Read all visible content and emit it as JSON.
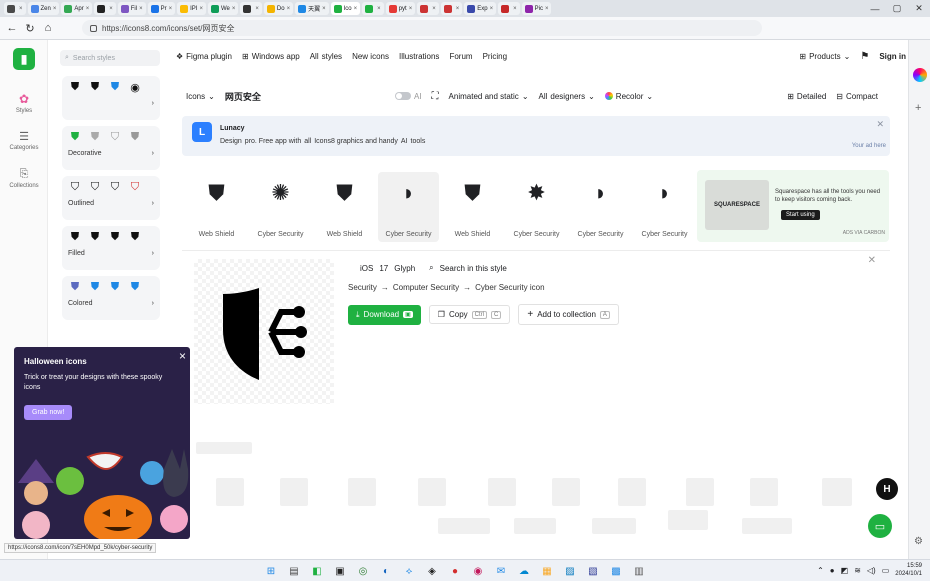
{
  "browser": {
    "tabs": [
      {
        "label": "",
        "color": "#4a4a4a"
      },
      {
        "label": "Zen",
        "color": "#4a86e8"
      },
      {
        "label": "Apr",
        "color": "#34a853"
      },
      {
        "label": "",
        "color": "#222222"
      },
      {
        "label": "Fil",
        "color": "#7e57c2"
      },
      {
        "label": "Pr",
        "color": "#1a73e8"
      },
      {
        "label": "IPI",
        "color": "#fbbc04"
      },
      {
        "label": "We",
        "color": "#0f9d58"
      },
      {
        "label": "",
        "color": "#333333"
      },
      {
        "label": "Do",
        "color": "#f4b400"
      },
      {
        "label": "天翼",
        "color": "#1e88e5"
      },
      {
        "label": "Ico",
        "color": "#1fb141"
      },
      {
        "label": "",
        "color": "#1fb141"
      },
      {
        "label": "pyt",
        "color": "#e53935"
      },
      {
        "label": "",
        "color": "#cc3333"
      },
      {
        "label": "",
        "color": "#cc3333"
      },
      {
        "label": "Exp",
        "color": "#3949ab"
      },
      {
        "label": "",
        "color": "#c62828"
      },
      {
        "label": "Pic",
        "color": "#8e24aa"
      }
    ],
    "url": "https://icons8.com/icons/set/网页安全",
    "window_controls": [
      "—",
      "▢",
      "✕"
    ]
  },
  "site": {
    "rail": {
      "styles_label": "Styles",
      "categories_label": "Categories",
      "collections_label": "Collections"
    },
    "filters": {
      "search_placeholder": "Search styles",
      "cards": [
        {
          "label": "",
          "icons": [
            "⛊",
            "⛊",
            "⛊",
            "◉"
          ]
        },
        {
          "label": "Decorative",
          "icons": [
            "⛊",
            "⛊",
            "⛉",
            "⛊"
          ]
        },
        {
          "label": "Outlined",
          "icons": [
            "⛉",
            "⛉",
            "⛉",
            "⛉"
          ]
        },
        {
          "label": "Filled",
          "icons": [
            "⛊",
            "⛊",
            "⛊",
            "⛊"
          ]
        },
        {
          "label": "Colored",
          "icons": [
            "⛊",
            "⛊",
            "⛊",
            "⛊"
          ]
        }
      ]
    },
    "topnav": {
      "figma_plugin": "Figma plugin",
      "windows_app": "Windows app",
      "all_prefix": "All",
      "styles": "styles",
      "new_icons": "New icons",
      "illustrations": "Illustrations",
      "forum": "Forum",
      "pricing": "Pricing",
      "products": "Products",
      "sign_in": "Sign in"
    },
    "toolbar": {
      "icons": "Icons",
      "query": "网页安全",
      "ai": "AI",
      "animated": "Animated and static",
      "all_prefix": "All",
      "designers": "designers",
      "recolor": "Recolor",
      "detailed": "Detailed",
      "compact": "Compact"
    },
    "promo": {
      "app": "Lunacy",
      "design": "Design",
      "with": "pro. Free app with",
      "all": "all",
      "graphics": "Icons8 graphics and handy",
      "all2": "AI",
      "tools": "tools",
      "your_ad": "Your ad here"
    },
    "icon_row": [
      {
        "glyph": "⛊",
        "name": "Web Shield"
      },
      {
        "glyph": "✺",
        "name": "Cyber Security"
      },
      {
        "glyph": "⛊",
        "name": "Web Shield"
      },
      {
        "glyph": "◗",
        "name": "Cyber Security"
      },
      {
        "glyph": "⛊",
        "name": "Web Shield"
      },
      {
        "glyph": "✸",
        "name": "Cyber Security"
      },
      {
        "glyph": "◗",
        "name": "Cyber Security"
      },
      {
        "glyph": "◗",
        "name": "Cyber Security"
      }
    ],
    "ad": {
      "brand": "SQUARESPACE",
      "text": "Squarespace has all the tools you need to keep visitors coming back.",
      "cta": "Start using",
      "via": "ADS VIA CARBON"
    },
    "detail": {
      "ios": "iOS",
      "num": "17",
      "glyph": "Glyph",
      "search_style": "Search in this style",
      "crumb1": "Security",
      "crumb2": "Computer Security",
      "crumb3": "Cyber Security icon",
      "arrow": "→",
      "download": "Download",
      "copy": "Copy",
      "ctrl": "Ctrl",
      "c": "C",
      "add_collection": "Add to collection",
      "a": "A"
    },
    "halloween": {
      "title": "Halloween icons",
      "text": "Trick or treat your designs with these spooky icons",
      "cta": "Grab now!"
    },
    "status_url": "https://icons8.com/icon/7sEH0Mpd_50k/cyber-security"
  },
  "taskbar": {
    "apps": [
      "⊞",
      "▤",
      "◧",
      "▣",
      "◎",
      "◐",
      "⟡",
      "◈",
      "●",
      "◉",
      "✉",
      "☁",
      "▦",
      "▨",
      "▧",
      "▩",
      "▥"
    ],
    "time": "15:59",
    "date": "2024/10/1"
  }
}
